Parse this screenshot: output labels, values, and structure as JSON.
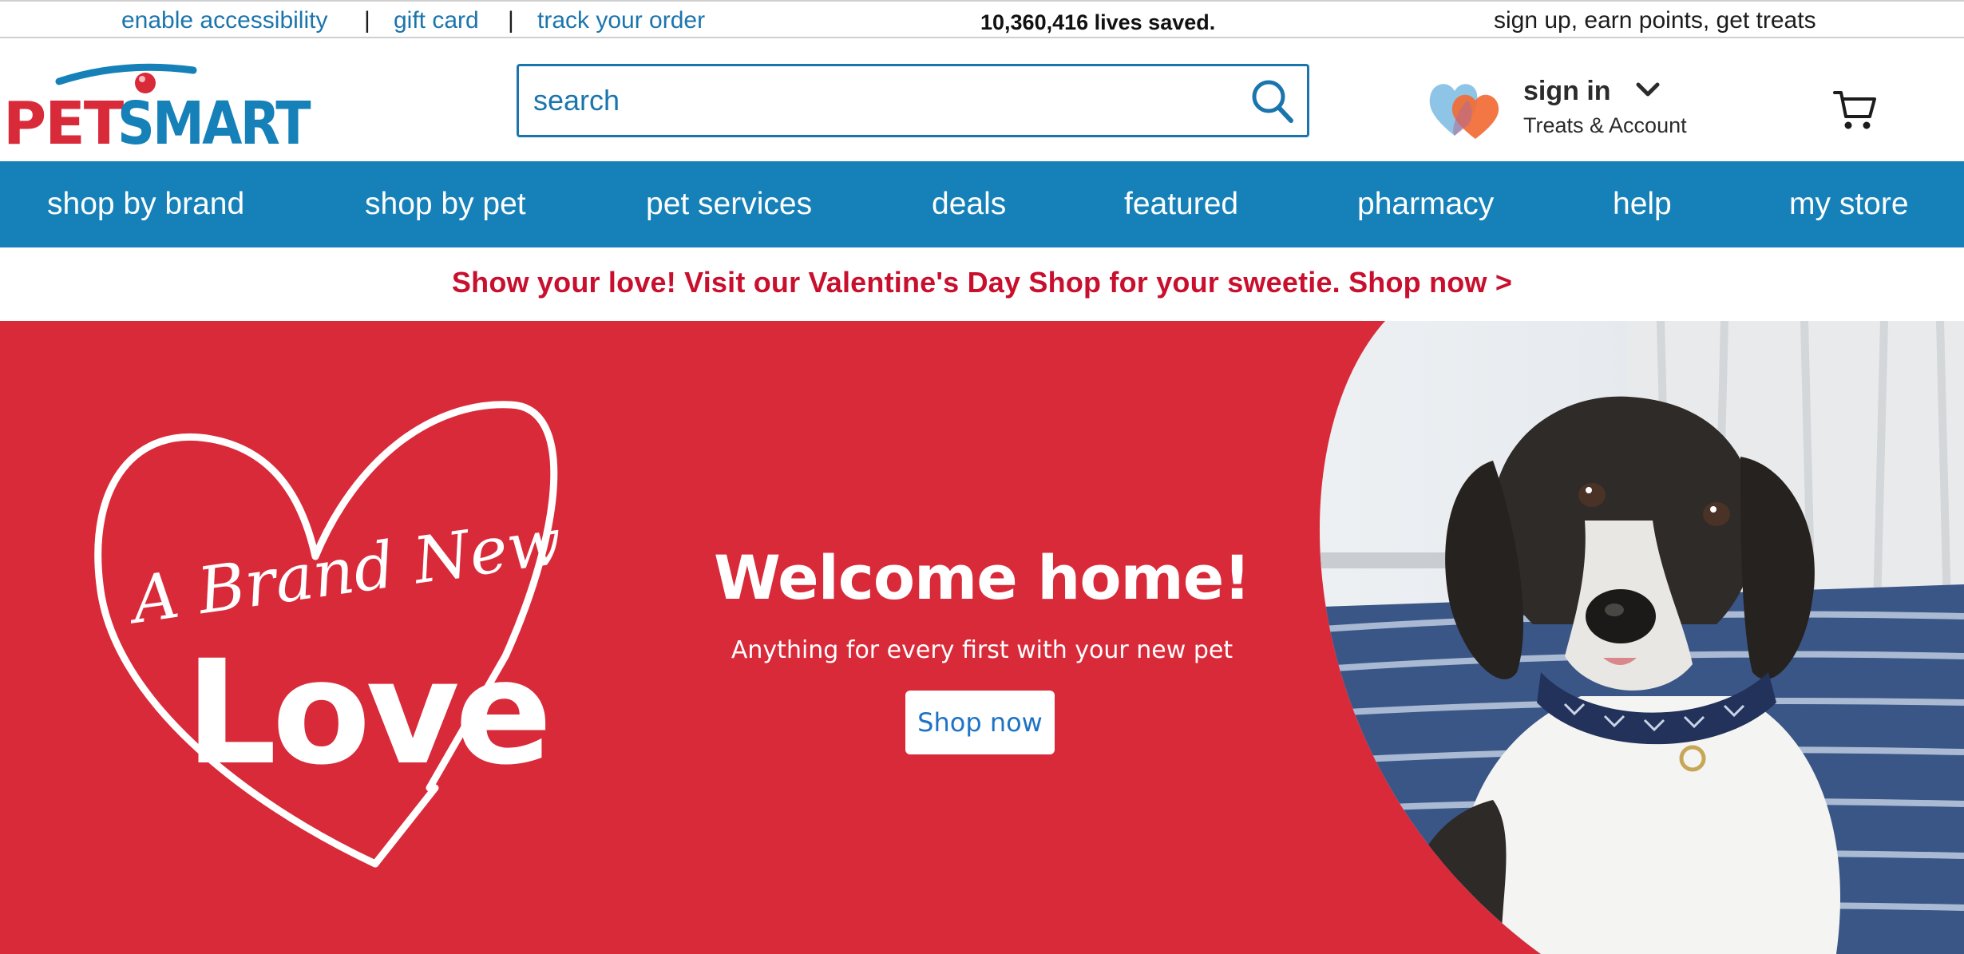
{
  "utility": {
    "accessibility": "enable accessibility",
    "separator": "|",
    "gift_card": "gift card",
    "track_order": "track your order",
    "lives_saved": "10,360,416 lives saved.",
    "promo": "sign up, earn points, get treats"
  },
  "header": {
    "logo_text": "PETSMART",
    "search_placeholder": "search",
    "signin_label": "sign in",
    "account_sub": "Treats & Account"
  },
  "nav": {
    "items": [
      "shop by brand",
      "shop by pet",
      "pet services",
      "deals",
      "featured",
      "pharmacy",
      "help",
      "my store"
    ]
  },
  "promo_banner": {
    "text": "Show your love! Visit our Valentine's Day Shop for your sweetie. Shop now >"
  },
  "hero": {
    "badge_script": "A Brand New",
    "badge_main": "Love",
    "title": "Welcome home!",
    "subtitle": "Anything for every first with your new pet",
    "cta": "Shop now"
  },
  "colors": {
    "brand_blue": "#1581b8",
    "link_blue": "#1b75ad",
    "hero_red": "#d92a3a",
    "promo_red": "#c8102e",
    "cta_text": "#1e73c5"
  },
  "icons": [
    "search-icon",
    "hearts-icon",
    "chevron-down-icon",
    "cart-icon"
  ]
}
